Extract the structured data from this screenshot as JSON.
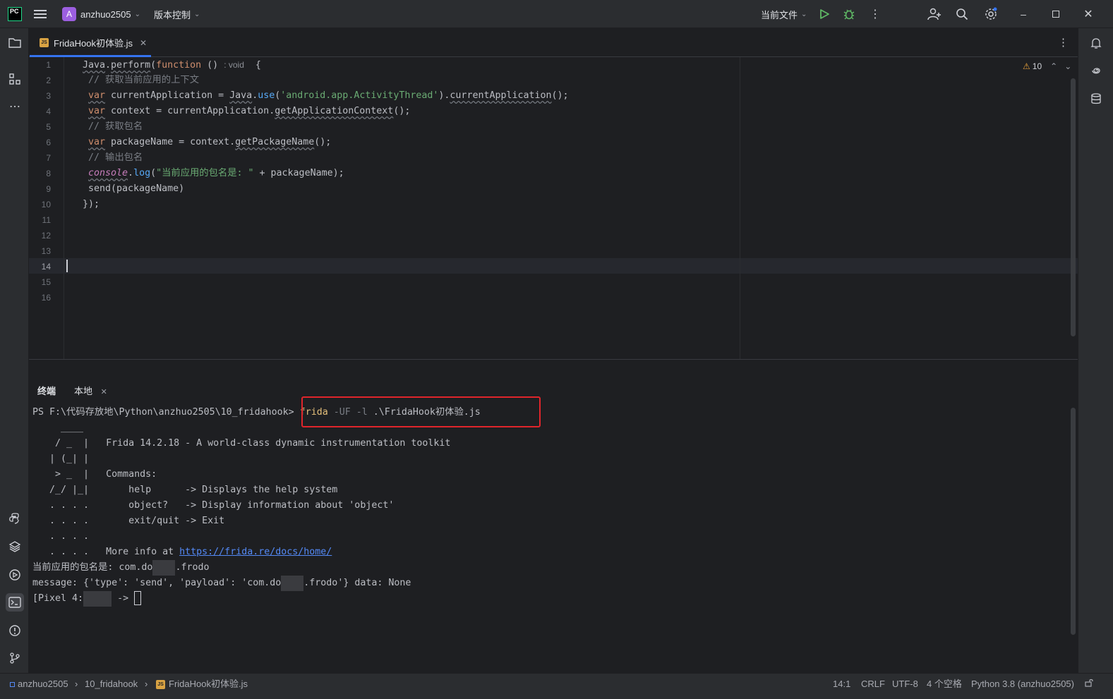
{
  "titlebar": {
    "logo_text": "PC",
    "project_initial": "A",
    "project_name": "anzhuo2505",
    "vcs_label": "版本控制",
    "run_config": "当前文件",
    "icons": [
      "hamburger-menu-icon",
      "run-icon",
      "debug-icon",
      "more-vert-icon",
      "add-user-icon",
      "search-icon",
      "settings-icon",
      "minimize-icon",
      "maximize-icon",
      "close-icon"
    ]
  },
  "editor_tab": {
    "badge": "JS",
    "filename": "FridaHook初体验.js"
  },
  "editor": {
    "warning_count": "10",
    "line_numbers": [
      "1",
      "2",
      "3",
      "4",
      "5",
      "6",
      "7",
      "8",
      "9",
      "10",
      "11",
      "12",
      "13",
      "14",
      "15",
      "16"
    ],
    "inlay_hint": ": void",
    "lines": {
      "l1_java": "Java",
      "l1_perform": "perform",
      "l1_kw": "function",
      "l1_paren": " () ",
      "l1_brace": "{",
      "l2": "// 获取当前应用的上下文",
      "l3_var": "var",
      "l3_a": " currentApplication = ",
      "l3_java": "Java",
      "l3_use": "use",
      "l3_str": "'android.app.ActivityThread'",
      "l3_call": "currentApplication",
      "l4_var": "var",
      "l4_a": " context = currentApplication.",
      "l4_call": "getApplicationContext",
      "l5": "// 获取包名",
      "l6_var": "var",
      "l6_a": " packageName = context.",
      "l6_call": "getPackageName",
      "l7": "// 输出包名",
      "l8_console": "console",
      "l8_log": "log",
      "l8_str": "\"当前应用的包名是: \"",
      "l8_b": " + packageName);",
      "l9": "send(packageName)",
      "l10": "});"
    }
  },
  "terminal": {
    "tab_label": "终端",
    "session_label": "本地",
    "prompt": "PS F:\\代码存放地\\Python\\anzhuo2505\\10_fridahook>",
    "cmd_name": "frida",
    "cmd_flags": " -UF -l ",
    "cmd_file": ".\\FridaHook初体验.js",
    "banner": [
      "     ____",
      "    / _  |   Frida 14.2.18 - A world-class dynamic instrumentation toolkit",
      "   | (_| |",
      "    > _  |   Commands:",
      "   /_/ |_|       help      -> Displays the help system",
      "   . . . .       object?   -> Display information about 'object'",
      "   . . . .       exit/quit -> Exit",
      "   . . . ."
    ],
    "more_info_prefix": "   . . . .   More info at ",
    "more_info_link": "https://frida.re/docs/home/",
    "out1_prefix": "当前应用的包名是: com.do",
    "out1_suffix": ".frodo",
    "out2_prefix": "message: {'type': 'send', 'payload': 'com.do",
    "out2_suffix": ".frodo'} data: None",
    "prompt2_prefix": "[Pixel 4:",
    "prompt2_suffix": " ->"
  },
  "statusbar": {
    "crumb_project": "anzhuo2505",
    "crumb_folder": "10_fridahook",
    "crumb_badge": "JS",
    "crumb_file": "FridaHook初体验.js",
    "position": "14:1",
    "line_sep": "CRLF",
    "encoding": "UTF-8",
    "indent": "4 个空格",
    "interpreter": "Python 3.8 (anzhuo2505)"
  }
}
